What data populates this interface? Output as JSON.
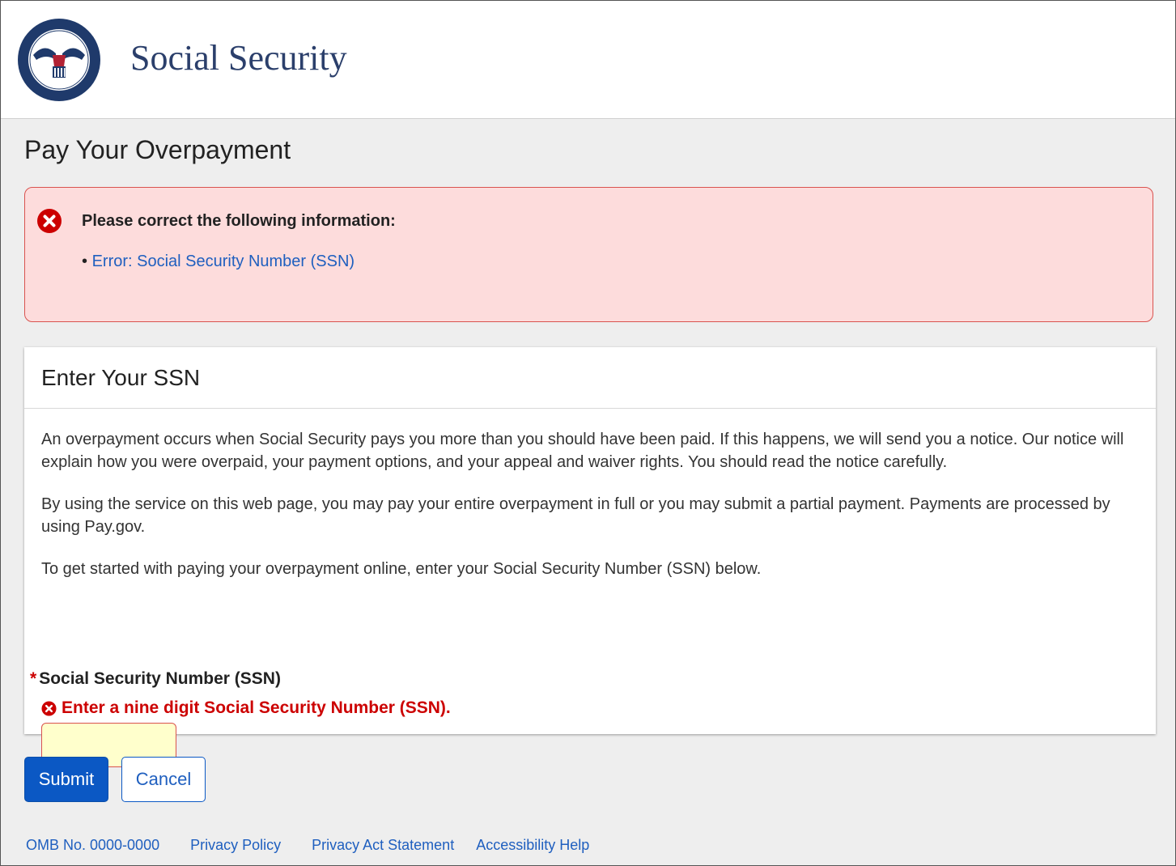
{
  "header": {
    "seal_text": "SOCIAL SECURITY ADMINISTRATION USA",
    "site_title": "Social Security"
  },
  "page": {
    "title": "Pay Your Overpayment"
  },
  "alert": {
    "heading": "Please correct the following information:",
    "items": [
      "Error: Social Security Number (SSN)"
    ]
  },
  "card": {
    "title": "Enter Your SSN",
    "paragraphs": [
      "An overpayment occurs when Social Security pays you more than you should have been paid. If this happens, we will send you a notice. Our notice will explain how you were overpaid, your payment options, and your appeal and waiver rights. You should read the notice carefully.",
      "By using the service on this web page, you may pay your entire overpayment in full or you may submit a partial payment. Payments are processed by using Pay.gov.",
      "To get started with paying your overpayment online, enter your Social Security Number (SSN) below."
    ],
    "field": {
      "required_marker": "*",
      "label": "Social Security Number (SSN)",
      "error": "Enter a nine digit Social Security Number (SSN).",
      "value": ""
    }
  },
  "buttons": {
    "submit": "Submit",
    "cancel": "Cancel"
  },
  "footer": {
    "links": [
      "OMB No. 0000-0000",
      "Privacy Policy",
      "Privacy Act Statement",
      "Accessibility Help"
    ]
  },
  "colors": {
    "brand_navy": "#2b3f6b",
    "error_red": "#cc0000",
    "primary_blue": "#0b58c4",
    "alert_bg": "#fddcdc",
    "input_error_bg": "#ffffcc"
  },
  "icons": {
    "seal": "ssa-seal-logo",
    "alert": "error-circle-icon",
    "field_error": "error-circle-icon"
  }
}
